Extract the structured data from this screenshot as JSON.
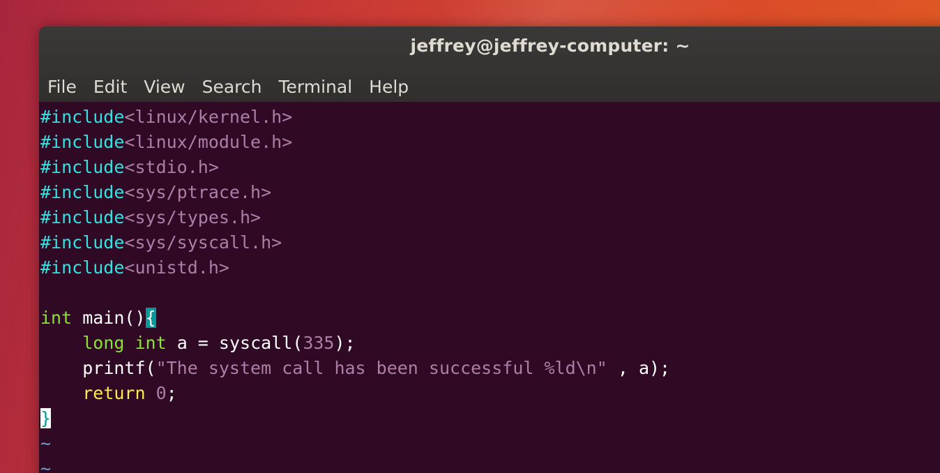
{
  "window": {
    "title": "jeffrey@jeffrey-computer: ~"
  },
  "menu": {
    "items": [
      "File",
      "Edit",
      "View",
      "Search",
      "Terminal",
      "Help"
    ]
  },
  "editor": {
    "includes": [
      {
        "directive": "#include",
        "header": "<linux/kernel.h>"
      },
      {
        "directive": "#include",
        "header": "<linux/module.h>"
      },
      {
        "directive": "#include",
        "header": "<stdio.h>"
      },
      {
        "directive": "#include",
        "header": "<sys/ptrace.h>"
      },
      {
        "directive": "#include",
        "header": "<sys/types.h>"
      },
      {
        "directive": "#include",
        "header": "<sys/syscall.h>"
      },
      {
        "directive": "#include",
        "header": "<unistd.h>"
      }
    ],
    "main_sig": {
      "type": "int",
      "rest": " main()",
      "open_brace": "{"
    },
    "decl": {
      "indent": "    ",
      "long": "long",
      "int": "int",
      "mid": " a = syscall(",
      "num": "335",
      "end": ");"
    },
    "printf_line": {
      "indent": "    ",
      "fn": "printf(",
      "str": "\"The system call has been successful %ld\\n\"",
      "end": " , a);"
    },
    "return_line": {
      "indent": "    ",
      "kw": "return",
      "space": " ",
      "num": "0",
      "end": ";"
    },
    "close_brace": "}",
    "tilde": "~"
  },
  "colors": {
    "terminal_bg": "#300a24",
    "titlebar_bg": "#3a3937",
    "preprocessor": "#34e2e2",
    "string_const": "#ad7fa8",
    "type": "#8ae234",
    "keyword": "#fce94f",
    "matching_bracket": "#06989a",
    "tilde": "#729fcf"
  }
}
